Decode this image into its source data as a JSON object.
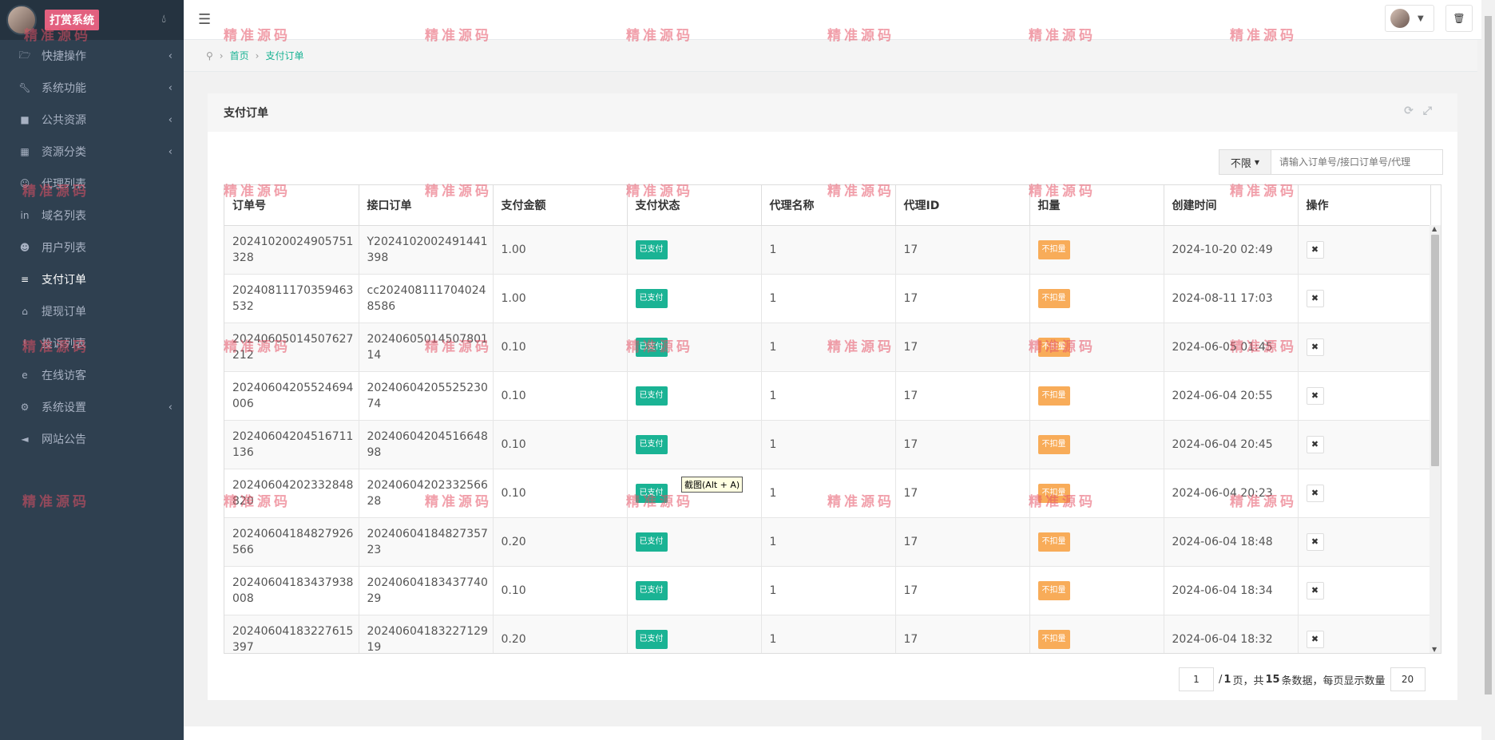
{
  "sidebar": {
    "brand": "打赏系统",
    "drop_icon": "droplet-icon",
    "items": [
      {
        "label": "快捷操作",
        "icon": "folder-open-icon",
        "has_children": true,
        "active": false
      },
      {
        "label": "系统功能",
        "icon": "wrench-icon",
        "has_children": true,
        "active": false
      },
      {
        "label": "公共资源",
        "icon": "video-camera-icon",
        "has_children": true,
        "active": false
      },
      {
        "label": "资源分类",
        "icon": "th-large-icon",
        "has_children": true,
        "active": false
      },
      {
        "label": "代理列表",
        "icon": "users-icon",
        "has_children": false,
        "active": false
      },
      {
        "label": "域名列表",
        "icon": "linkedin-icon",
        "has_children": false,
        "active": false
      },
      {
        "label": "用户列表",
        "icon": "user-icon",
        "has_children": false,
        "active": false
      },
      {
        "label": "支付订单",
        "icon": "database-icon",
        "has_children": false,
        "active": true
      },
      {
        "label": "提现订单",
        "icon": "bank-icon",
        "has_children": false,
        "active": false
      },
      {
        "label": "投诉列表",
        "icon": "exclamation-circle-icon",
        "has_children": false,
        "active": false
      },
      {
        "label": "在线访客",
        "icon": "internet-explorer-icon",
        "has_children": false,
        "active": false
      },
      {
        "label": "系统设置",
        "icon": "gear-icon",
        "has_children": true,
        "active": false
      },
      {
        "label": "网站公告",
        "icon": "bullhorn-icon",
        "has_children": false,
        "active": false
      }
    ]
  },
  "breadcrumb": {
    "home": "首页",
    "current": "支付订单"
  },
  "panel": {
    "title": "支付订单"
  },
  "filter": {
    "selected": "不限",
    "placeholder": "请输入订单号/接口订单号/代理"
  },
  "table": {
    "columns": [
      "订单号",
      "接口订单",
      "支付金额",
      "支付状态",
      "代理名称",
      "代理ID",
      "扣量",
      "创建时间",
      "操作"
    ],
    "rows": [
      {
        "order_no": "20241020024905751328",
        "api_order": "Y2024102002491441398",
        "amount": "1.00",
        "status": "已支付",
        "agent_name": "1",
        "agent_id": "17",
        "deduct": "不扣量",
        "created": "2024-10-20 02:49"
      },
      {
        "order_no": "20240811170359463532",
        "api_order": "cc2024081117040248586",
        "amount": "1.00",
        "status": "已支付",
        "agent_name": "1",
        "agent_id": "17",
        "deduct": "不扣量",
        "created": "2024-08-11 17:03"
      },
      {
        "order_no": "20240605014507627212",
        "api_order": "2024060501450780114",
        "amount": "0.10",
        "status": "已支付",
        "agent_name": "1",
        "agent_id": "17",
        "deduct": "不扣量",
        "created": "2024-06-05 01:45"
      },
      {
        "order_no": "20240604205524694006",
        "api_order": "2024060420552523074",
        "amount": "0.10",
        "status": "已支付",
        "agent_name": "1",
        "agent_id": "17",
        "deduct": "不扣量",
        "created": "2024-06-04 20:55"
      },
      {
        "order_no": "20240604204516711136",
        "api_order": "2024060420451664898",
        "amount": "0.10",
        "status": "已支付",
        "agent_name": "1",
        "agent_id": "17",
        "deduct": "不扣量",
        "created": "2024-06-04 20:45"
      },
      {
        "order_no": "20240604202332848820",
        "api_order": "2024060420233256628",
        "amount": "0.10",
        "status": "已支付",
        "agent_name": "1",
        "agent_id": "17",
        "deduct": "不扣量",
        "created": "2024-06-04 20:23"
      },
      {
        "order_no": "20240604184827926566",
        "api_order": "2024060418482735723",
        "amount": "0.20",
        "status": "已支付",
        "agent_name": "1",
        "agent_id": "17",
        "deduct": "不扣量",
        "created": "2024-06-04 18:48"
      },
      {
        "order_no": "20240604183437938008",
        "api_order": "2024060418343774029",
        "amount": "0.10",
        "status": "已支付",
        "agent_name": "1",
        "agent_id": "17",
        "deduct": "不扣量",
        "created": "2024-06-04 18:34"
      },
      {
        "order_no": "20240604183227615397",
        "api_order": "2024060418322712919",
        "amount": "0.20",
        "status": "已支付",
        "agent_name": "1",
        "agent_id": "17",
        "deduct": "不扣量",
        "created": "2024-06-04 18:32"
      }
    ],
    "delete_glyph": "✖"
  },
  "tooltip": "截图(Alt + A)",
  "pager": {
    "current_page": "1",
    "text_total_pages_prefix": "/",
    "total_pages": "1",
    "text_page_unit": "页，共",
    "total_records": "15",
    "text_records_suffix": "条数据，每页显示数量",
    "page_size": "20"
  },
  "watermark": "精准源码",
  "colors": {
    "sidebar_bg": "#2f4050",
    "accent": "#1ab394",
    "warning": "#f8ac59",
    "brand": "#e2607f"
  }
}
